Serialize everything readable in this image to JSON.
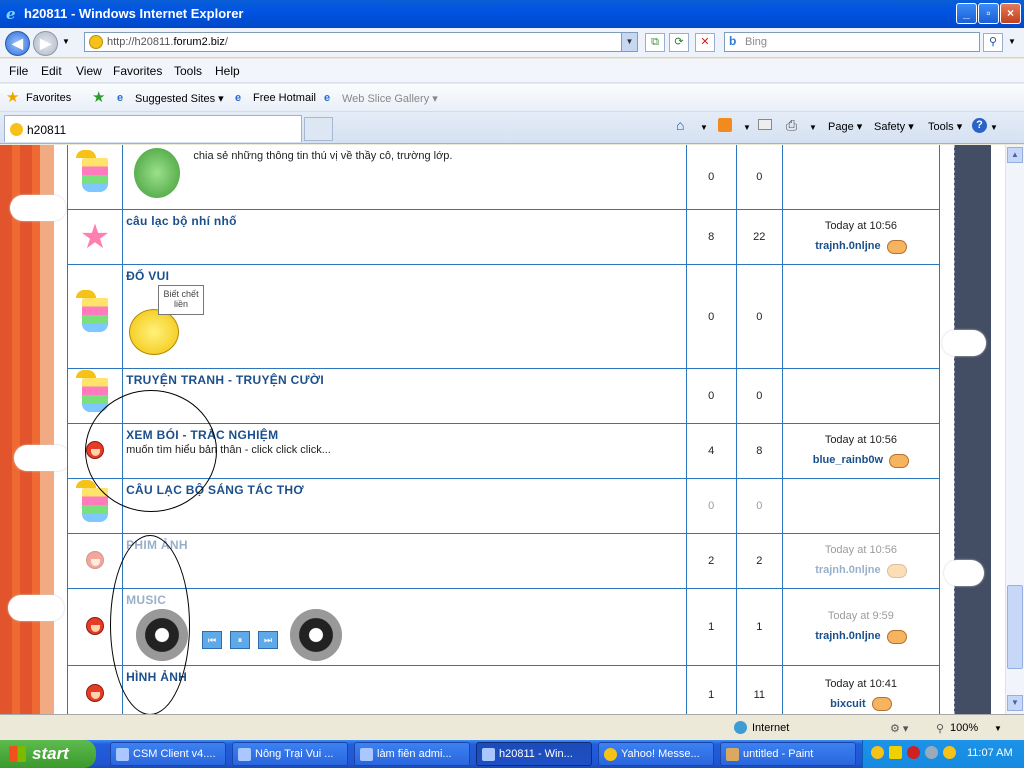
{
  "window": {
    "title": "h20811 - Windows Internet Explorer"
  },
  "address": {
    "url_prefix": "http://h20811.",
    "url_domain": "forum2.biz",
    "url_suffix": "/"
  },
  "search": {
    "placeholder": "Bing",
    "logo": "b"
  },
  "menu": [
    "File",
    "Edit",
    "View",
    "Favorites",
    "Tools",
    "Help"
  ],
  "favorites": {
    "label": "Favorites",
    "items": [
      "Suggested Sites ▾",
      "Free Hotmail",
      "Web Slice Gallery ▾"
    ]
  },
  "tab": {
    "title": "h20811"
  },
  "commandbar": {
    "page": "Page ▾",
    "safety": "Safety ▾",
    "tools": "Tools ▾",
    "help": "? ▾"
  },
  "forums": [
    {
      "name": "",
      "desc": "chia sẻ những thông tin thú vị về thầy cô, trường lớp.",
      "topics": "0",
      "posts": "0",
      "last_time": "",
      "last_user": "",
      "icon": "cup"
    },
    {
      "name": "câu lạc bộ nhí nhố",
      "desc": "",
      "topics": "8",
      "posts": "22",
      "last_time": "Today at 10:56",
      "last_user": "trajnh.0nljne",
      "icon": "star"
    },
    {
      "name": "ĐỐ VUI",
      "desc": "",
      "topics": "0",
      "posts": "0",
      "last_time": "",
      "last_user": "",
      "icon": "cup",
      "sign": "Biết chết liền"
    },
    {
      "name": "TRUYỆN TRANH - TRUYỆN CƯỜI",
      "desc": "",
      "topics": "0",
      "posts": "0",
      "last_time": "",
      "last_user": "",
      "icon": "cup"
    },
    {
      "name": "XEM BÓI - TRẮC NGHIỆM",
      "desc": "muốn tìm hiểu bản thân - click click click...",
      "topics": "4",
      "posts": "8",
      "last_time": "Today at 10:56",
      "last_user": "blue_rainb0w",
      "icon": "redface"
    },
    {
      "name": "CÂU LẠC BỘ SÁNG TÁC THƠ",
      "desc": "",
      "topics": "0",
      "posts": "0",
      "last_time": "",
      "last_user": "",
      "icon": "cup"
    },
    {
      "name": "PHIM ẢNH",
      "desc": "",
      "topics": "2",
      "posts": "2",
      "last_time": "Today at 10:56",
      "last_user": "trajnh.0nljne",
      "icon": "redface"
    },
    {
      "name": "MUSIC",
      "desc": "",
      "topics": "1",
      "posts": "1",
      "last_time": "Today at 9:59",
      "last_user": "trajnh.0nljne",
      "icon": "redface"
    },
    {
      "name": "HÌNH ẢNH",
      "desc": "",
      "topics": "1",
      "posts": "11",
      "last_time": "Today at 10:41",
      "last_user": "bixcuit",
      "icon": "redface"
    }
  ],
  "status": {
    "zone": "Internet",
    "zoom": "100%"
  },
  "taskbar": {
    "start": "start",
    "tasks": [
      "CSM Client v4....",
      "Nông Trại Vui ...",
      "làm fiên admi...",
      "h20811 - Win...",
      "Yahoo! Messe...",
      "untitled - Paint"
    ],
    "clock": "11:07 AM"
  }
}
